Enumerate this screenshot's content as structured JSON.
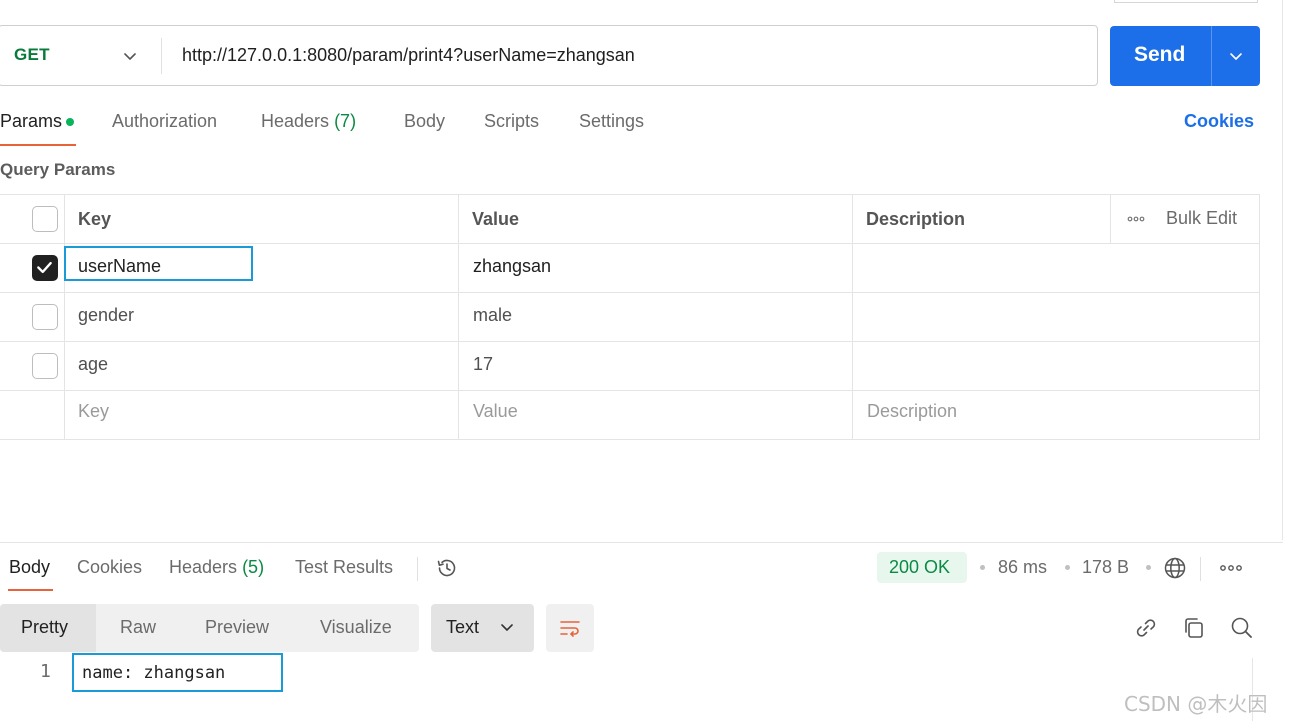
{
  "request": {
    "method": "GET",
    "url": "http://127.0.0.1:8080/param/print4?userName=zhangsan",
    "send_label": "Send"
  },
  "request_tabs": {
    "params": "Params",
    "authorization": "Authorization",
    "headers": "Headers",
    "headers_count": "(7)",
    "body": "Body",
    "scripts": "Scripts",
    "settings": "Settings",
    "cookies": "Cookies"
  },
  "query_params": {
    "title": "Query Params",
    "columns": {
      "key": "Key",
      "value": "Value",
      "description": "Description"
    },
    "bulk_edit": "Bulk Edit",
    "rows": [
      {
        "key": "userName",
        "value": "zhangsan",
        "checked": true
      },
      {
        "key": "gender",
        "value": "male",
        "checked": false
      },
      {
        "key": "age",
        "value": "17",
        "checked": false
      }
    ],
    "placeholders": {
      "key": "Key",
      "value": "Value",
      "description": "Description"
    }
  },
  "response": {
    "tabs": {
      "body": "Body",
      "cookies": "Cookies",
      "headers": "Headers",
      "headers_count": "(5)",
      "test_results": "Test Results"
    },
    "status": "200 OK",
    "time": "86 ms",
    "size": "178 B",
    "formats": {
      "pretty": "Pretty",
      "raw": "Raw",
      "preview": "Preview",
      "visualize": "Visualize"
    },
    "text_type": "Text",
    "line_number": "1",
    "code_line": "name: zhangsan"
  },
  "watermark": "CSDN @木火因",
  "colors": {
    "accent": "#1c6fe8",
    "method_green": "#0a7a3a",
    "status_green": "#0b8a45",
    "tab_underline": "#e8623a",
    "highlight_box": "#1a9ad6"
  }
}
